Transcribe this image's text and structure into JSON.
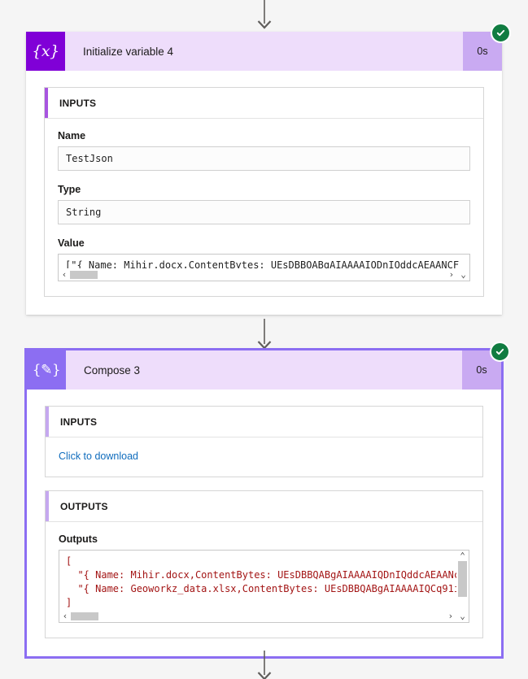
{
  "flow": {
    "connectors": [
      {
        "name": "connector-top"
      },
      {
        "name": "connector-middle"
      },
      {
        "name": "connector-bottom"
      }
    ],
    "actions": [
      {
        "id": "initialize-variable-4",
        "title": "Initialize variable 4",
        "icon": "{x}",
        "icon_name": "initialize-variable-icon",
        "duration": "0s",
        "status": "succeeded",
        "status_icon": "checkmark-icon",
        "selected": false,
        "sections": [
          {
            "label": "INPUTS",
            "accent": "#a855e0",
            "fields": [
              {
                "label": "Name",
                "value": "TestJson"
              },
              {
                "label": "Type",
                "value": "String"
              },
              {
                "label": "Value",
                "value": "[\"{ Name: Mihir.docx,ContentBytes: UEsDBBQABgAIAAAAIQDnIQddcAEAANCF",
                "scrollable": true
              }
            ]
          }
        ]
      },
      {
        "id": "compose-3",
        "title": "Compose 3",
        "icon": "{✎}",
        "icon_name": "compose-icon",
        "duration": "0s",
        "status": "succeeded",
        "status_icon": "checkmark-icon",
        "selected": true,
        "sections": [
          {
            "label": "INPUTS",
            "accent": "#c5a8ef",
            "link": "Click to download"
          },
          {
            "label": "OUTPUTS",
            "accent": "#c5a8ef",
            "fields": [
              {
                "label": "Outputs",
                "value": "[\n  \"{ Name: Mihir.docx,ContentBytes: UEsDBBQABgAIAAAAIQDnIQddcAEAANc\n  \"{ Name: Geoworkz_data.xlsx,ContentBytes: UEsDBBQABgAIAAAAIQCq91i\n]",
                "scrollable": true,
                "multiline": true
              }
            ]
          }
        ]
      }
    ]
  },
  "scrollbars": {
    "left_arrow": "‹",
    "right_arrow": "›",
    "up_arrow": "⌃",
    "down_arrow": "⌄"
  },
  "colors": {
    "canvas": "#f5f5f5",
    "init_icon": "#8000d7",
    "compose_icon": "#8c6ef2",
    "header_bg": "#eeddfb",
    "duration_bg": "#c9aaf2",
    "selection_border": "#8c6ef2",
    "success_green": "#107c41",
    "link_blue": "#0f6cbd",
    "code_red": "#a31515"
  }
}
